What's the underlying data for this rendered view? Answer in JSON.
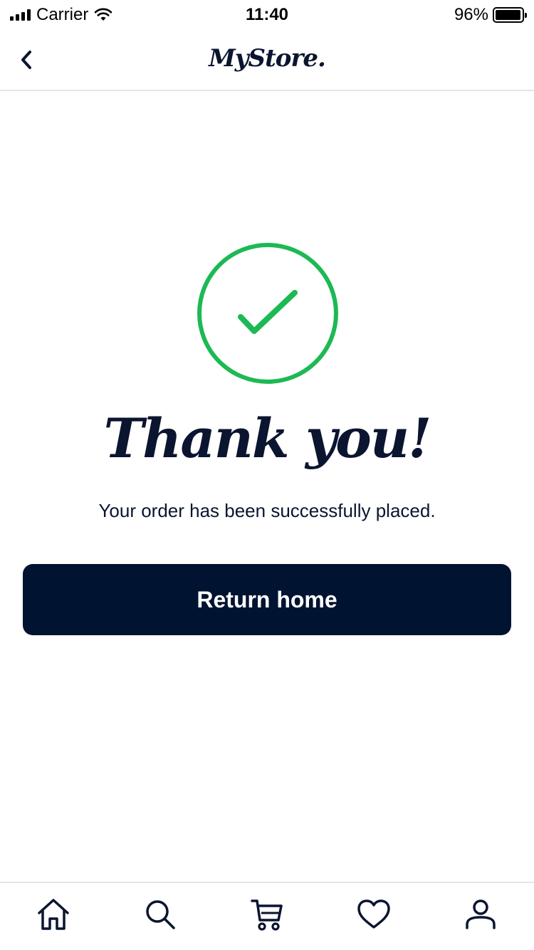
{
  "status_bar": {
    "carrier": "Carrier",
    "time": "11:40",
    "battery_percent": "96%",
    "battery_level": 0.96
  },
  "nav": {
    "back_icon": "chevron-left-icon",
    "logo_text": "MyStore."
  },
  "main": {
    "success_icon": "check-circle-icon",
    "success_color": "#1db954",
    "heading": "Thank you!",
    "message": "Your order has been successfully placed.",
    "return_button_label": "Return home",
    "return_button_color": "#001330"
  },
  "tab_bar": {
    "items": [
      {
        "icon": "home-icon"
      },
      {
        "icon": "search-icon"
      },
      {
        "icon": "cart-icon"
      },
      {
        "icon": "heart-icon"
      },
      {
        "icon": "profile-icon"
      }
    ]
  }
}
